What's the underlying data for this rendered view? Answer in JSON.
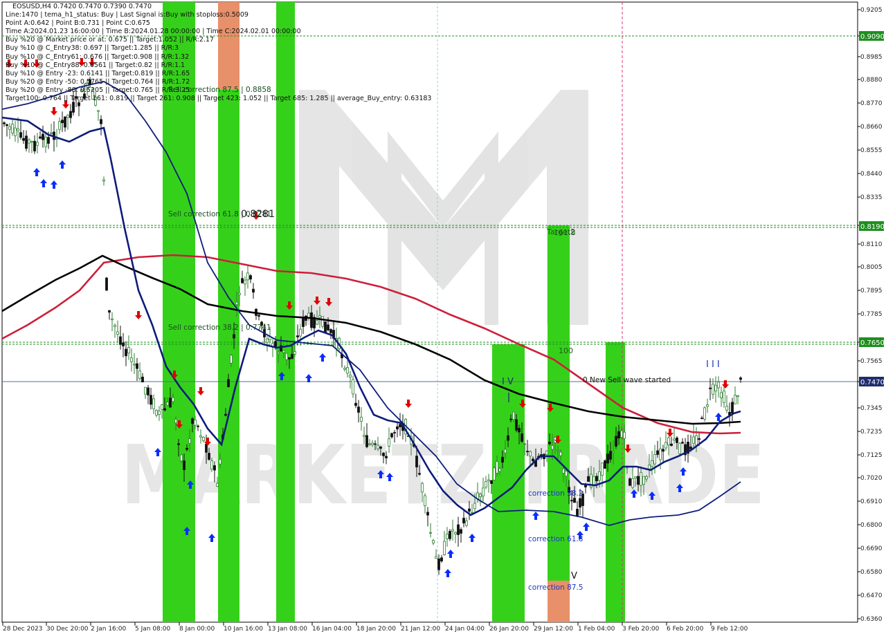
{
  "window": {
    "symbol_line": "EOSUSD,H4  0.7420 0.7470 0.7390 0.7470"
  },
  "info_lines": [
    "Line:1470 | tema_h1_status: Buy | Last Signal is:Buy with stoploss:0.5009",
    "Point A:0.642 | Point B:0.731 | Point C:0.675",
    "Time A:2024.01.23 16:00:00 | Time B:2024.01.28 00:00:00 | Time C:2024.02.01 00:00:00",
    "Buy %20 @ Market price or at: 0.675 || Target:1.052 || R/R:2.17",
    "Buy %10 @ C_Entry38: 0.697 || Target:1.285 || R/R:3",
    "Buy %10 @ C_Entry61: 0.676 || Target:0.908 || R/R:1.32",
    "Buy %10 @ C_Entry88: 0.6561 || Target:0.82 || R/R:1.1",
    "Buy %10 @ Entry -23: 0.6141 || Target:0.819 || R/R:1.65",
    "Buy %20 @ Entry -50: 0.5765 || Target:0.764 || R/R:1.72",
    "Buy %20 @ Entry -88: 0.5205 || Target:0.765 || R/R:3.25",
    "Target100: 0.764 || Target 161: 0.819 || Target 261: 0.908 || Target 423: 1.052 || Target 685: 1.285 || average_Buy_entry: 0.63183"
  ],
  "price_axis": [
    "0.9205",
    "0.9090",
    "0.8985",
    "0.8880",
    "0.8770",
    "0.8660",
    "0.8555",
    "0.8440",
    "0.8335",
    "0.8190",
    "0.8110",
    "0.8005",
    "0.7895",
    "0.7785",
    "0.7650",
    "0.7565",
    "0.7470",
    "0.7345",
    "0.7235",
    "0.7125",
    "0.7020",
    "0.6910",
    "0.6800",
    "0.6690",
    "0.6580",
    "0.6470",
    "0.6360"
  ],
  "price_tags": {
    "upper": "0.9090",
    "middle": "0.8190",
    "lower": "0.7650",
    "current": "0.7470"
  },
  "time_axis": [
    "28 Dec 2023",
    "30 Dec 20:00",
    "2 Jan 16:00",
    "5 Jan 08:00",
    "8 Jan 00:00",
    "10 Jan 16:00",
    "13 Jan 08:00",
    "16 Jan 04:00",
    "18 Jan 20:00",
    "21 Jan 12:00",
    "24 Jan 04:00",
    "26 Jan 20:00",
    "29 Jan 12:00",
    "1 Feb 04:00",
    "3 Feb 20:00",
    "6 Feb 20:00",
    "9 Feb 12:00"
  ],
  "annotations": {
    "sell_correction_875": "Sell correction 87.5 | 0.8858",
    "sell_correction_618": "Sell correction 61.8 | 0.8281",
    "sell_correction_382": "Sell correction 38.2 | 0.7741",
    "big_label": "0.8281",
    "target_label": "Target2",
    "target_161": "161.8",
    "level_100": "100",
    "wave_iv": "I V",
    "wave_iii": "I I I",
    "wave_v": "V",
    "new_sell_wave": "0 New Sell wave started",
    "correction_382": "correction 38.2",
    "correction_618": "correction 61.8",
    "correction_875": "correction 87.5"
  },
  "watermark": "MARKETZITRADE",
  "colors": {
    "bull_candle": "#2e7d32",
    "bear_candle": "#111111",
    "ema_red": "#cc1f3a",
    "ema_black": "#000000",
    "ma_navy": "#0d1c7a",
    "zone_green": "#35d11a",
    "zone_orange": "#e8906a",
    "level_green": "#1e8f1e",
    "tag_green": "#1e8f1e",
    "tag_navy": "#1f2d6e",
    "arrow_up": "#0a2cff",
    "arrow_down": "#e00000"
  }
}
